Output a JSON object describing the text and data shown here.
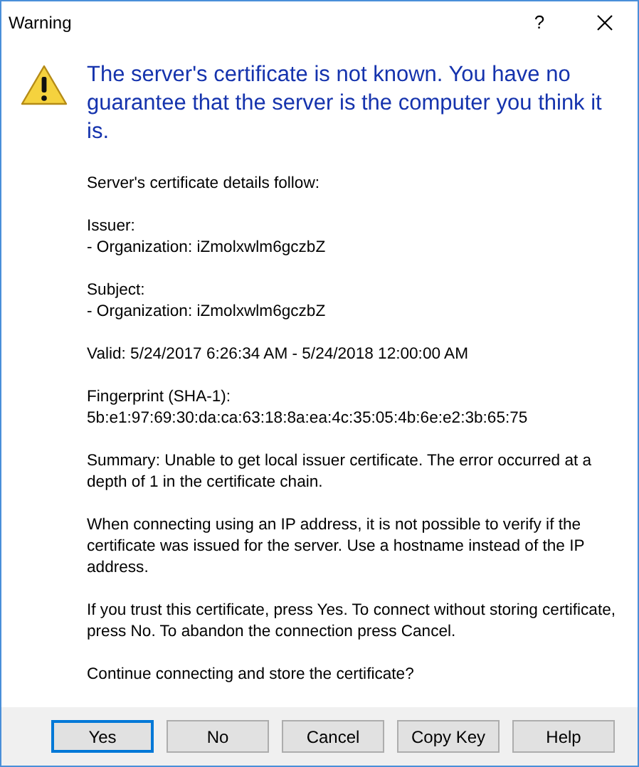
{
  "window": {
    "title": "Warning",
    "help_glyph": "?"
  },
  "heading": "The server's certificate is not known. You have no guarantee that the server is the computer you think it is.",
  "paragraphs": [
    {
      "lines": [
        "Server's certificate details follow:"
      ]
    },
    {
      "lines": [
        "Issuer:",
        "- Organization: iZmolxwlm6gczbZ"
      ]
    },
    {
      "lines": [
        "Subject:",
        "- Organization: iZmolxwlm6gczbZ"
      ]
    },
    {
      "lines": [
        "Valid: 5/24/2017 6:26:34 AM - 5/24/2018 12:00:00 AM"
      ]
    },
    {
      "lines": [
        "Fingerprint (SHA-1):",
        "5b:e1:97:69:30:da:ca:63:18:8a:ea:4c:35:05:4b:6e:e2:3b:65:75"
      ]
    },
    {
      "lines": [
        "Summary: Unable to get local issuer certificate. The error occurred at a depth of 1 in the certificate chain."
      ]
    },
    {
      "lines": [
        "When connecting using an IP address, it is not possible to verify if the certificate was issued for the server. Use a hostname instead of the IP address."
      ]
    },
    {
      "lines": [
        "If you trust this certificate, press Yes. To connect without storing certificate, press No. To abandon the connection press Cancel."
      ]
    },
    {
      "lines": [
        "Continue connecting and store the certificate?"
      ]
    }
  ],
  "buttons": [
    {
      "label": "Yes",
      "default": true
    },
    {
      "label": "No",
      "default": false
    },
    {
      "label": "Cancel",
      "default": false
    },
    {
      "label": "Copy Key",
      "default": false
    },
    {
      "label": "Help",
      "default": false
    }
  ]
}
